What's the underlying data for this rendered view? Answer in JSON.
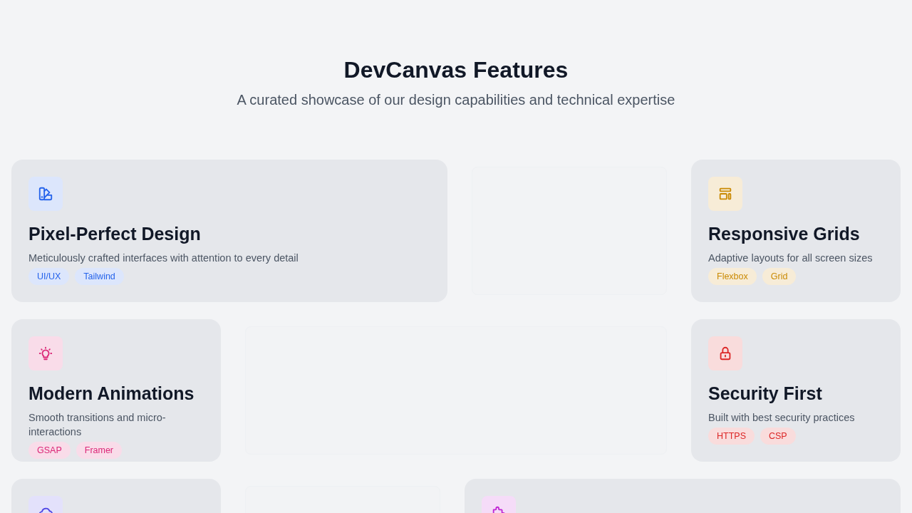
{
  "header": {
    "title": "DevCanvas Features",
    "subtitle": "A curated showcase of our design capabilities and technical expertise"
  },
  "slots": [
    {
      "kind": "feature",
      "wide": true,
      "color": "#2563eb",
      "title": "Pixel-Perfect Design",
      "description": "Meticulously crafted interfaces with attention to every detail",
      "tags": [
        "UI/UX",
        "Tailwind"
      ]
    },
    {
      "kind": "empty",
      "wide": false
    },
    {
      "kind": "feature",
      "wide": false,
      "color": "#ca8a04",
      "title": "Responsive Grids",
      "description": "Adaptive layouts for all screen sizes",
      "tags": [
        "Flexbox",
        "Grid"
      ]
    },
    {
      "kind": "feature",
      "wide": false,
      "color": "#db2777",
      "title": "Modern Animations",
      "description": "Smooth transitions and micro-interactions",
      "tags": [
        "GSAP",
        "Framer"
      ]
    },
    {
      "kind": "empty",
      "wide": true
    },
    {
      "kind": "feature",
      "wide": false,
      "color": "#dc2626",
      "title": "Security First",
      "description": "Built with best security practices",
      "tags": [
        "HTTPS",
        "CSP"
      ]
    },
    {
      "kind": "feature",
      "wide": false,
      "color": "#4f46e5"
    },
    {
      "kind": "empty",
      "wide": false
    },
    {
      "kind": "feature",
      "wide": true,
      "color": "#c026d3"
    }
  ]
}
